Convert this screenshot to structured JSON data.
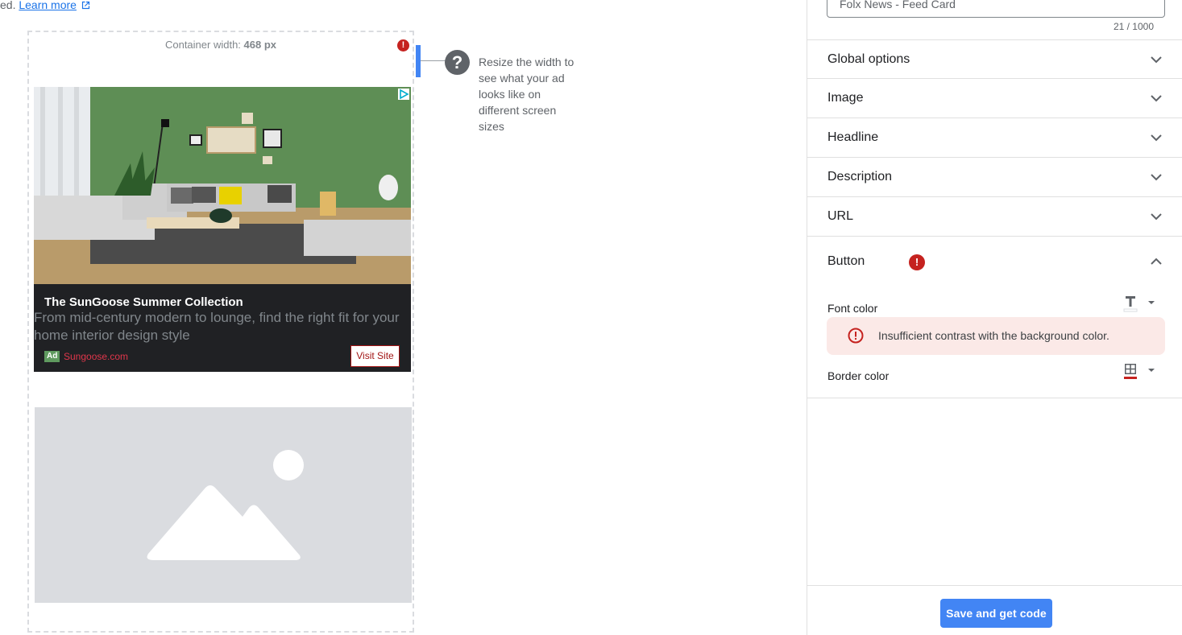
{
  "top_note": {
    "prefix": "ed. ",
    "link": "Learn more"
  },
  "preview": {
    "container_label": "Container width: ",
    "container_width": "468 px",
    "error_marker": "!",
    "help_glyph": "?",
    "help_text": "Resize the width to see what your ad looks like on different screen sizes"
  },
  "ad": {
    "headline": "The SunGoose Summer Collection",
    "description": "From mid-century modern to lounge, find the right fit for your home interior design style",
    "badge": "Ad",
    "url": "Sungoose.com",
    "button": "Visit Site"
  },
  "panel": {
    "name_value": "Folx News - Feed Card",
    "counter": "21 / 1000",
    "sections": [
      {
        "label": "Global options"
      },
      {
        "label": "Image"
      },
      {
        "label": "Headline"
      },
      {
        "label": "Description"
      },
      {
        "label": "URL"
      }
    ],
    "button_section": {
      "label": "Button",
      "error_marker": "!",
      "font_color_label": "Font color",
      "warning": "Insufficient contrast with the background color.",
      "border_color_label": "Border color"
    },
    "save_button": "Save and get code"
  },
  "colors": {
    "accent": "#4285f4",
    "error": "#c5221f",
    "warning_bg": "#fbe9e7",
    "ad_bg": "#202124",
    "ad_url": "#e0364b",
    "ad_button": "#a31515"
  }
}
